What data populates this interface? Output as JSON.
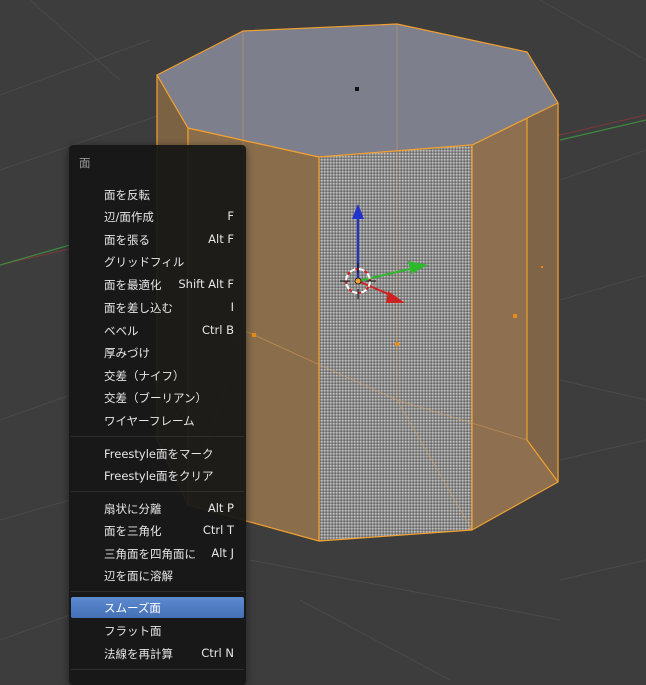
{
  "menu": {
    "title": "面",
    "items": [
      {
        "label": "面を反転",
        "shortcut": ""
      },
      {
        "label": "辺/面作成",
        "shortcut": "F"
      },
      {
        "label": "面を張る",
        "shortcut": "Alt F"
      },
      {
        "label": "グリッドフィル",
        "shortcut": ""
      },
      {
        "label": "面を最適化",
        "shortcut": "Shift Alt F"
      },
      {
        "label": "面を差し込む",
        "shortcut": "I"
      },
      {
        "label": "ベベル",
        "shortcut": "Ctrl B"
      },
      {
        "label": "厚みづけ",
        "shortcut": ""
      },
      {
        "label": "交差（ナイフ）",
        "shortcut": ""
      },
      {
        "label": "交差（ブーリアン）",
        "shortcut": ""
      },
      {
        "label": "ワイヤーフレーム",
        "shortcut": ""
      },
      {
        "label": "Freestyle面をマーク",
        "shortcut": ""
      },
      {
        "label": "Freestyle面をクリア",
        "shortcut": ""
      },
      {
        "label": "扇状に分離",
        "shortcut": "Alt P"
      },
      {
        "label": "面を三角化",
        "shortcut": "Ctrl T"
      },
      {
        "label": "三角面を四角面に",
        "shortcut": "Alt J"
      },
      {
        "label": "辺を面に溶解",
        "shortcut": ""
      },
      {
        "label": "スムーズ面",
        "shortcut": ""
      },
      {
        "label": "フラット面",
        "shortcut": ""
      },
      {
        "label": "法線を再計算",
        "shortcut": "Ctrl N"
      }
    ]
  },
  "colors": {
    "viewport_bg": "#3d3d3d",
    "selection_orange": "#e8962a",
    "menu_bg": "#161616",
    "menu_highlight": "#5680c2",
    "axis_x_red": "#cc2222",
    "axis_y_green": "#2db82d",
    "axis_z_blue": "#2233cc"
  },
  "icons": [
    "manipulator-x-arrow-icon",
    "manipulator-y-arrow-icon",
    "manipulator-z-arrow-icon",
    "3d-cursor-icon"
  ]
}
